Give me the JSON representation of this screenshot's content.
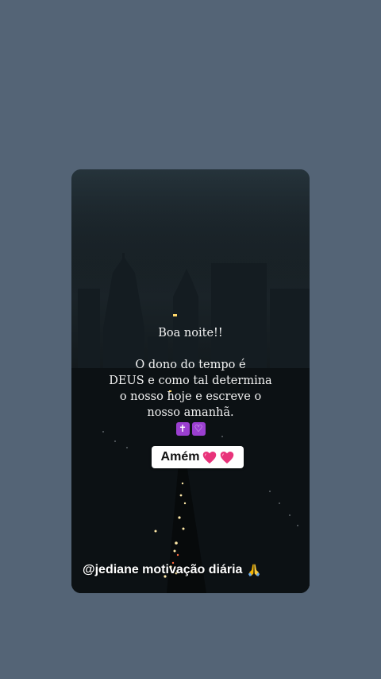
{
  "story": {
    "greeting": "Boa noite!!",
    "message_lines": [
      "O dono do tempo é",
      "DEUS e como tal determina",
      "o nosso hoje e escreve o",
      "nosso amanhã."
    ],
    "emojis": [
      "latin-cross-icon",
      "white-heart-icon"
    ],
    "cross_glyph": "✝",
    "heart_glyph": "♡"
  },
  "sticker": {
    "label": "Amém",
    "icons": [
      "pink-heart-icon",
      "pink-heart-icon"
    ],
    "heart_color": "#e8337a"
  },
  "caption": {
    "handle": "@jediane motivação diária",
    "icon": "folded-hands-icon"
  },
  "colors": {
    "background": "#546476",
    "emoji_box": "#9b3fd0"
  }
}
